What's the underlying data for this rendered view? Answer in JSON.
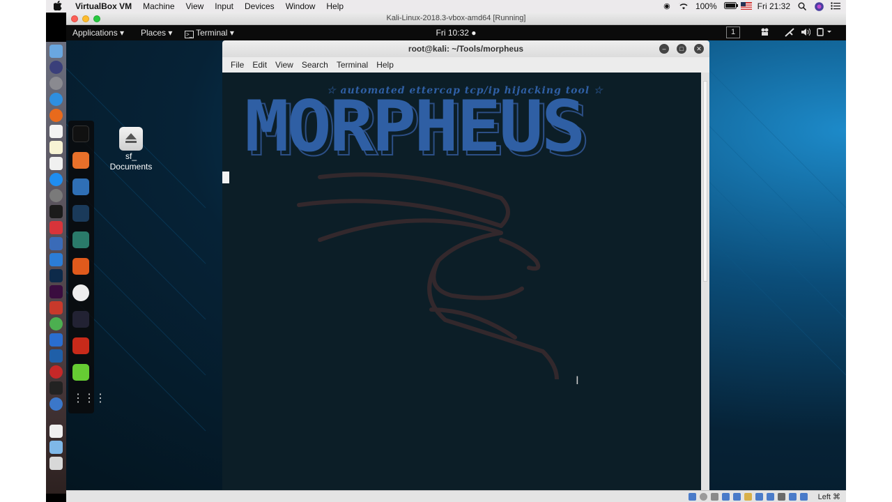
{
  "mac_menubar": {
    "apple": "",
    "app_name": "VirtualBox VM",
    "items": [
      "Machine",
      "View",
      "Input",
      "Devices",
      "Window",
      "Help"
    ],
    "battery": "100%",
    "clock": "Fri 21:32"
  },
  "vbox": {
    "title": "Kali-Linux-2018.3-vbox-amd64 [Running]",
    "host_key": "Left ⌘"
  },
  "kali_panel": {
    "applications": "Applications",
    "places": "Places",
    "terminal": "Terminal",
    "clock": "Fri 10:32",
    "workspace": "1"
  },
  "desktop": {
    "drive_label": "sf_\nDocuments"
  },
  "terminal": {
    "title": "root@kali: ~/Tools/morpheus",
    "menu": [
      "File",
      "Edit",
      "View",
      "Search",
      "Terminal",
      "Help"
    ],
    "banner_tagline": "automated ettercap tcp/ip hijacking tool",
    "banner_title": "MORPHEUS"
  },
  "colors": {
    "banner_blue": "#2f5fa4",
    "terminal_bg": "#0c1e27",
    "dragon": "#3a2a2e"
  }
}
